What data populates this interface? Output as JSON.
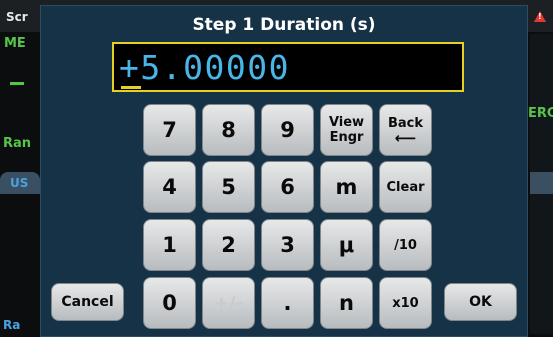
{
  "background": {
    "left_title": "Scr",
    "left_measure": "ME",
    "left_range": "Ran",
    "left_tab": "US",
    "left_bottom": "Ra",
    "right_label": "ERC"
  },
  "dialog": {
    "title": "Step 1 Duration (s)",
    "value": "+5.00000"
  },
  "keys": {
    "k7": "7",
    "k8": "8",
    "k9": "9",
    "view_engr_line1": "View",
    "view_engr_line2": "Engr",
    "back_label": "Back",
    "back_arrow": "⟵",
    "k4": "4",
    "k5": "5",
    "k6": "6",
    "milli": "m",
    "clear": "Clear",
    "k1": "1",
    "k2": "2",
    "k3": "3",
    "micro": "μ",
    "div10": "/10",
    "cancel": "Cancel",
    "k0": "0",
    "plus_minus": "+/-",
    "decimal": ".",
    "nano": "n",
    "x10": "x10",
    "ok": "OK"
  },
  "colors": {
    "dialog_bg": "#163246",
    "display_border": "#e7d021",
    "display_text": "#49b6ea",
    "accent_green": "#57c44a",
    "warning_red": "#e03a2f"
  }
}
